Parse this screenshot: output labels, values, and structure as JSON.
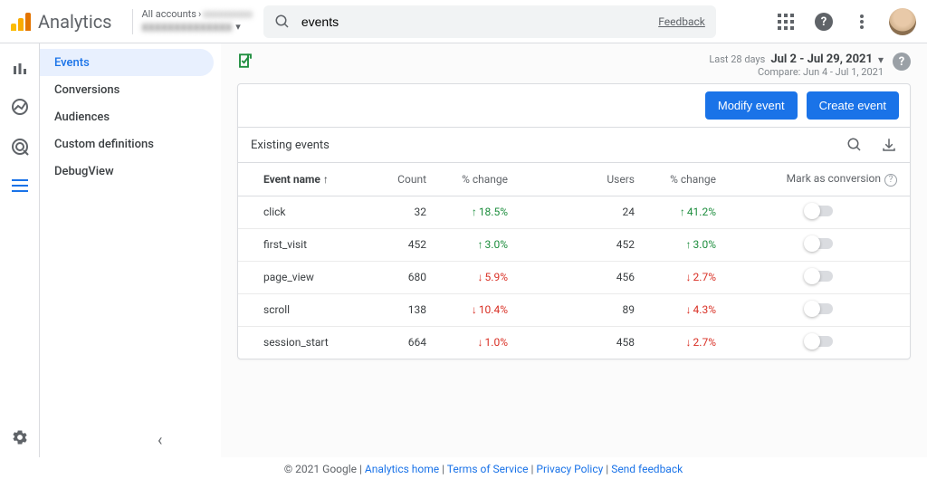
{
  "brand": "Analytics",
  "account_selector": {
    "line1": "All accounts"
  },
  "search": {
    "value": "events",
    "feedback": "Feedback"
  },
  "sidebar": {
    "items": [
      {
        "label": "Events"
      },
      {
        "label": "Conversions"
      },
      {
        "label": "Audiences"
      },
      {
        "label": "Custom definitions"
      },
      {
        "label": "DebugView"
      }
    ]
  },
  "date_block": {
    "prefix": "Last 28 days",
    "range": "Jul 2 - Jul 29, 2021",
    "compare": "Compare: Jun 4 - Jul 1, 2021"
  },
  "buttons": {
    "modify": "Modify event",
    "create": "Create event"
  },
  "table": {
    "title": "Existing events",
    "headers": {
      "name": "Event name",
      "count": "Count",
      "change1": "% change",
      "users": "Users",
      "change2": "% change",
      "mark": "Mark as conversion"
    },
    "rows": [
      {
        "name": "click",
        "count": "32",
        "c1": "18.5%",
        "d1": "up",
        "users": "24",
        "c2": "41.2%",
        "d2": "up"
      },
      {
        "name": "first_visit",
        "count": "452",
        "c1": "3.0%",
        "d1": "up",
        "users": "452",
        "c2": "3.0%",
        "d2": "up"
      },
      {
        "name": "page_view",
        "count": "680",
        "c1": "5.9%",
        "d1": "down",
        "users": "456",
        "c2": "2.7%",
        "d2": "down"
      },
      {
        "name": "scroll",
        "count": "138",
        "c1": "10.4%",
        "d1": "down",
        "users": "89",
        "c2": "4.3%",
        "d2": "down"
      },
      {
        "name": "session_start",
        "count": "664",
        "c1": "1.0%",
        "d1": "down",
        "users": "458",
        "c2": "2.7%",
        "d2": "down"
      }
    ]
  },
  "footer": {
    "copyright": "© 2021 Google",
    "links": [
      "Analytics home",
      "Terms of Service",
      "Privacy Policy",
      "Send feedback"
    ]
  }
}
